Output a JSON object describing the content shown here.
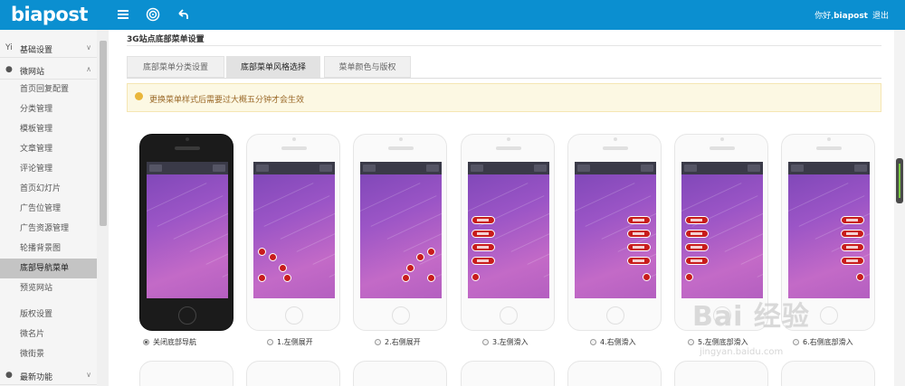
{
  "header": {
    "logo": "biapost",
    "greeting_prefix": "你好,",
    "username": "biapost",
    "logout": "退出",
    "bg_color": "#0b8fd0"
  },
  "sidebar": {
    "sections": [
      {
        "label": "基础设置",
        "icon": "Yi"
      },
      {
        "label": "微网站",
        "icon": "●"
      },
      {
        "label": "最新功能",
        "icon": "●"
      }
    ],
    "items": [
      "首页回复配置",
      "分类管理",
      "模板管理",
      "文章管理",
      "评论管理",
      "首页幻灯片",
      "广告位管理",
      "广告资源管理",
      "轮播背景图",
      "底部导航菜单",
      "预览网站",
      "版权设置",
      "微名片",
      "微街景"
    ],
    "active_index": 9
  },
  "page": {
    "title": "3G站点底部菜单设置"
  },
  "tabs": [
    "底部菜单分类设置",
    "底部菜单风格选择",
    "菜单颜色与版权"
  ],
  "notice": "更换菜单样式后需要过大概五分钟才会生效",
  "options": [
    "关闭底部导航",
    "1.左侧展开",
    "2.右侧展开",
    "3.左侧滑入",
    "4.右侧滑入",
    "5.左侧底部滑入",
    "6.右侧底部滑入"
  ],
  "phone": {
    "nav_back": "返回",
    "nav_more": "•••"
  },
  "watermark": {
    "text": "Bai 经验",
    "url": "jingyan.baidu.com"
  }
}
